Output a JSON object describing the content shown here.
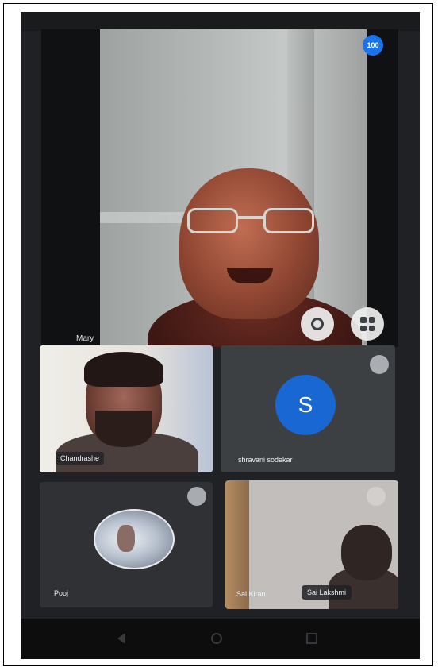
{
  "main_speaker": {
    "name": "Mary",
    "badge": "100"
  },
  "participants": [
    {
      "name": "Chandrashe"
    },
    {
      "initial": "S",
      "name": "shravani sodekar"
    },
    {
      "name": "Pooj"
    },
    {
      "name_left": "Sai Kiran",
      "name_right": "Sai Lakshmi"
    }
  ],
  "icons": {
    "camera_switch": "camera-switch-icon",
    "layout": "layout-grid-icon",
    "mic_off": "mic-off-icon"
  },
  "colors": {
    "background": "#202124",
    "accent": "#1a73e8",
    "avatar": "#1967d2"
  }
}
